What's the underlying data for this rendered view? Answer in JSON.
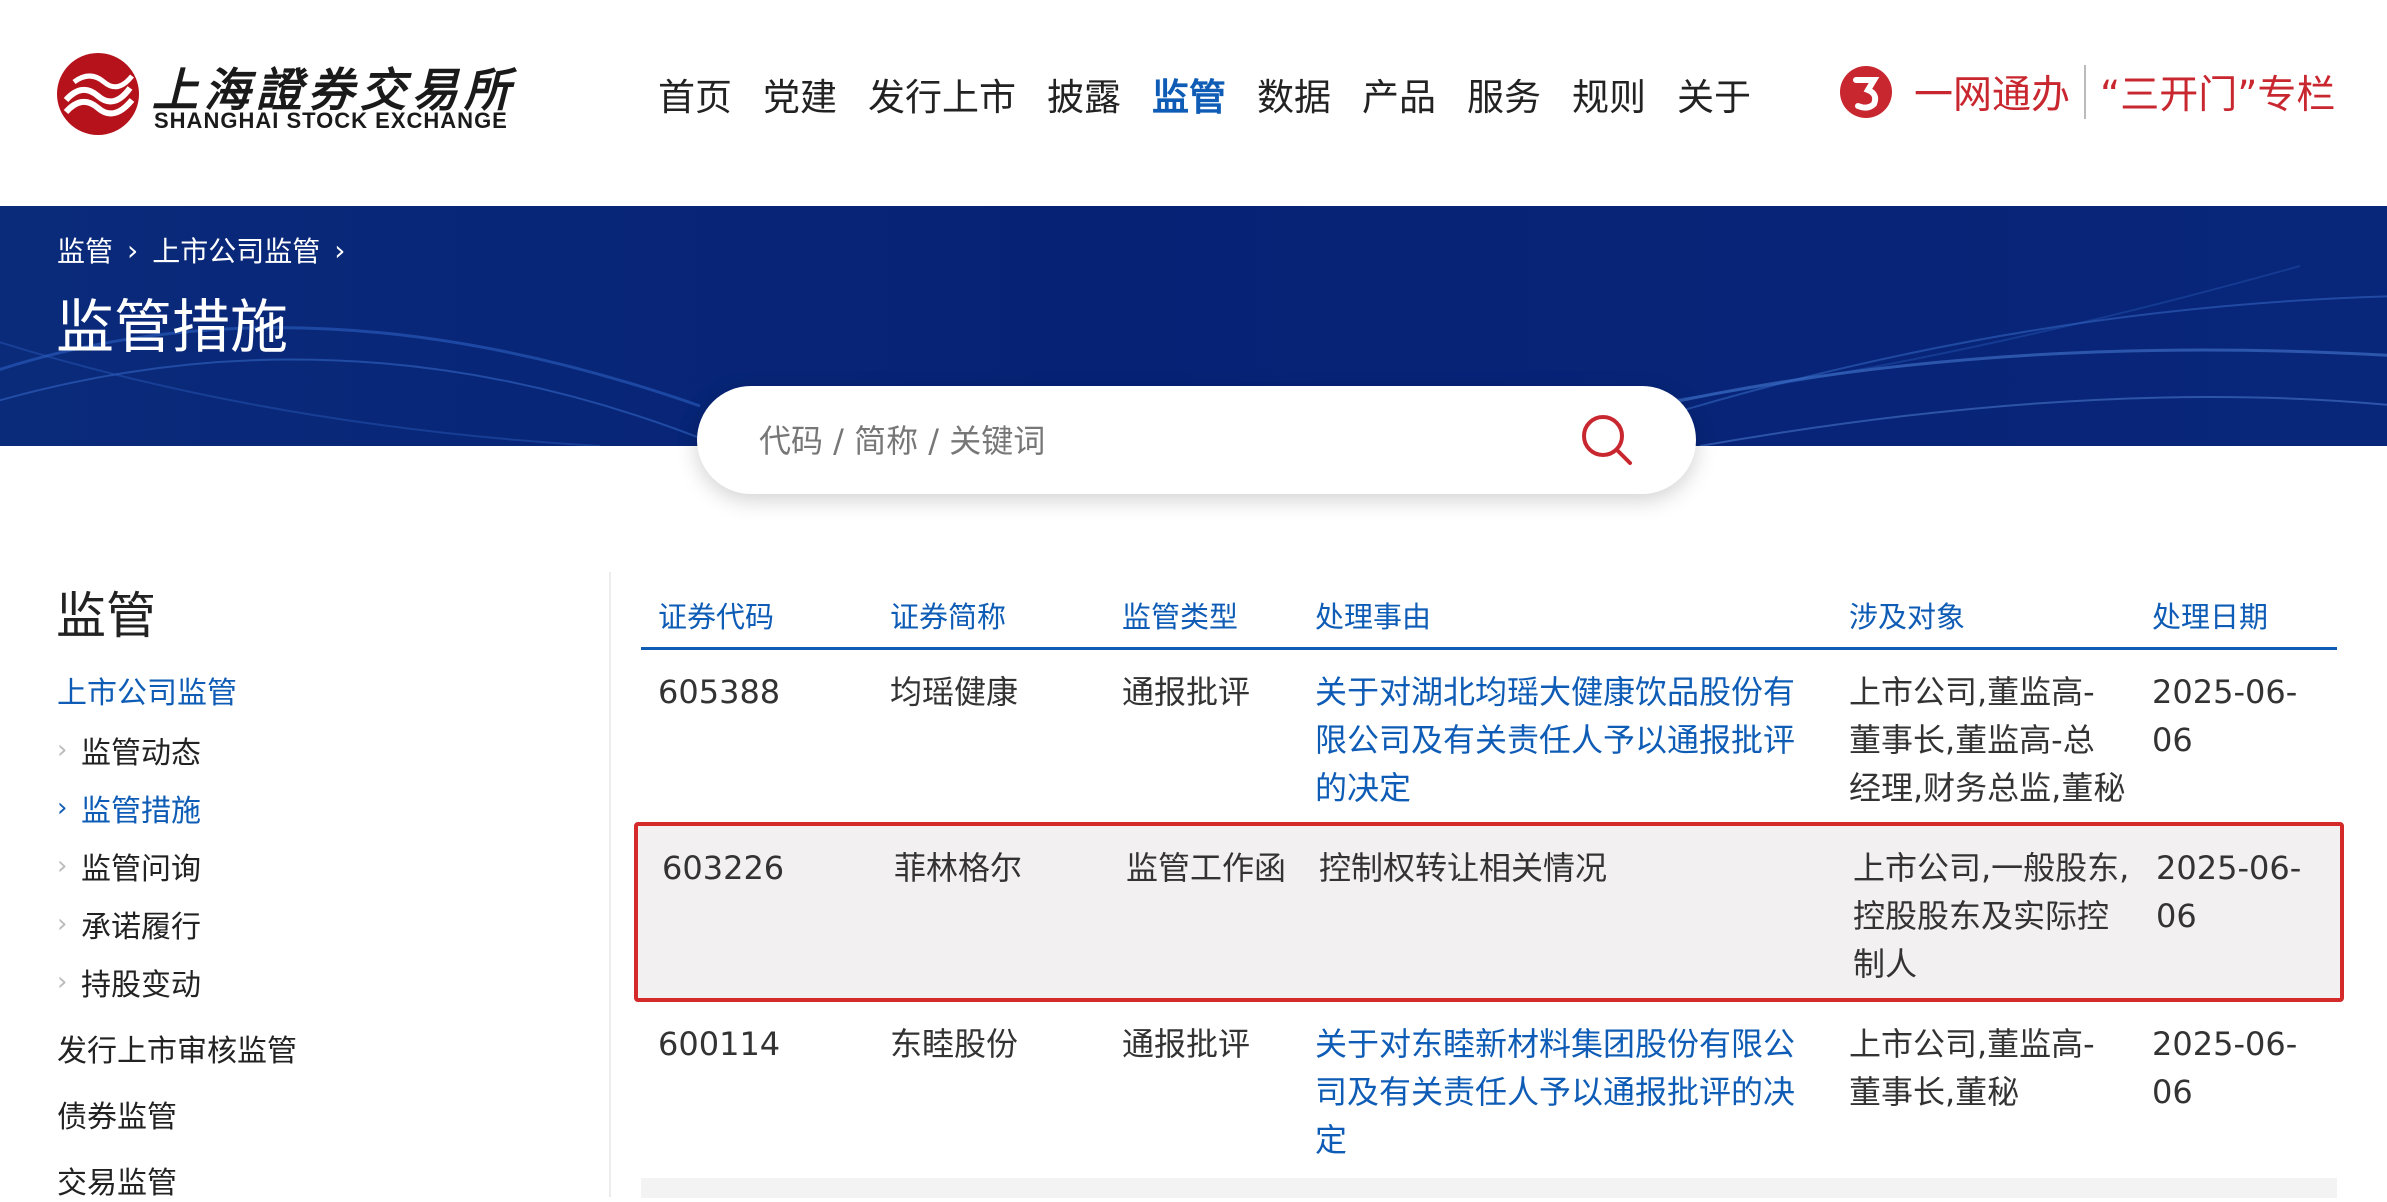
{
  "brand": {
    "cn_name": "上海證券交易所",
    "en_name": "SHANGHAI STOCK EXCHANGE",
    "logo_color": "#b5121b"
  },
  "nav": {
    "items": [
      "首页",
      "党建",
      "发行上市",
      "披露",
      "监管",
      "数据",
      "产品",
      "服务",
      "规则",
      "关于"
    ],
    "active": "监管"
  },
  "header_right": {
    "yiwang_label": "一网通办",
    "sankai_label": "“三开门”专栏",
    "accent": "#c9272f"
  },
  "breadcrumb": [
    "监管",
    "上市公司监管"
  ],
  "page_title": "监管措施",
  "search": {
    "placeholder": "代码 / 简称 / 关键词"
  },
  "sidebar": {
    "title": "监管",
    "section": "上市公司监管",
    "sub_items": [
      "监管动态",
      "监管措施",
      "监管问询",
      "承诺履行",
      "持股变动"
    ],
    "active_sub": "监管措施",
    "other_sections": [
      "发行上市审核监管",
      "债券监管",
      "交易监管"
    ]
  },
  "table": {
    "headers": [
      "证券代码",
      "证券简称",
      "监管类型",
      "处理事由",
      "涉及对象",
      "处理日期"
    ],
    "rows": [
      {
        "code": "605388",
        "name": "均瑶健康",
        "type": "通报批评",
        "reason_lines": [
          "关于对湖北均瑶大健康饮品股份有",
          "限公司及有关责任人予以通报批评",
          "的决定"
        ],
        "reason_is_link": true,
        "target_lines": [
          "上市公司,董监高-",
          "董事长,董监高-总",
          "经理,财务总监,董秘"
        ],
        "date": "2025-06-06"
      },
      {
        "code": "603226",
        "name": "菲林格尔",
        "type": "监管工作函",
        "reason_lines": [
          "控制权转让相关情况"
        ],
        "reason_is_link": false,
        "target_lines": [
          "上市公司,一般股东,",
          "控股股东及实际控",
          "制人"
        ],
        "date": "2025-06-06",
        "highlighted": true
      },
      {
        "code": "600114",
        "name": "东睦股份",
        "type": "通报批评",
        "reason_lines": [
          "关于对东睦新材料集团股份有限公",
          "司及有关责任人予以通报批评的决",
          "定"
        ],
        "reason_is_link": true,
        "target_lines": [
          "上市公司,董监高-",
          "董事长,董秘"
        ],
        "date": "2025-06-06"
      }
    ]
  },
  "colors": {
    "link_blue": "#0e5cb5",
    "banner_blue": "#062275",
    "highlight_border": "#d42a2a"
  }
}
